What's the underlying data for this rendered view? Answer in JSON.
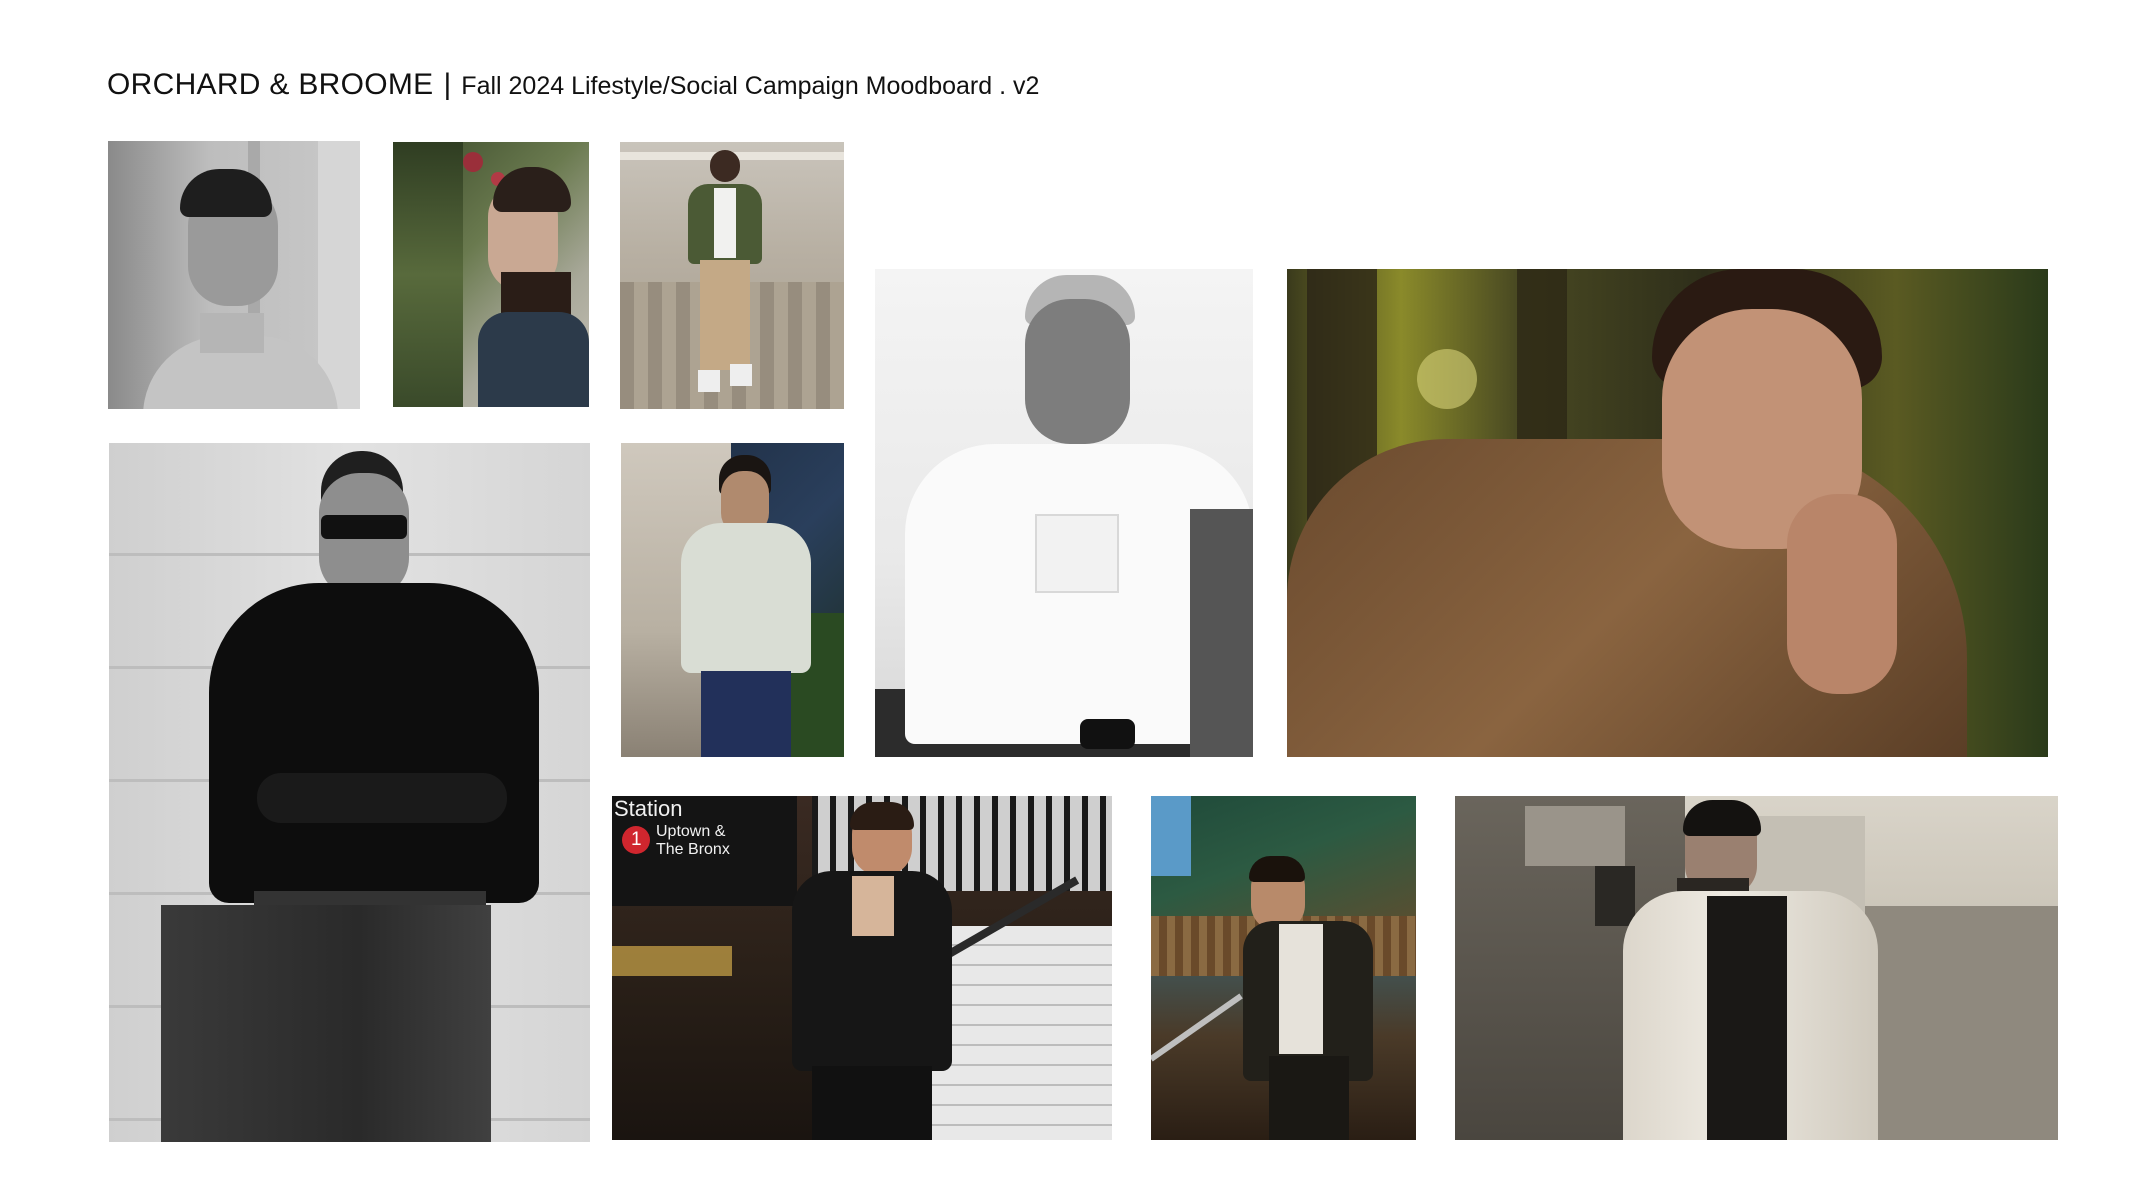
{
  "header": {
    "brand": "ORCHARD & BROOME",
    "separator": "|",
    "subtitle": "Fall 2024 Lifestyle/Social Campaign Moodboard . v2"
  },
  "photos": [
    {
      "id": "bw-man-sweatshirt",
      "style": "black-and-white"
    },
    {
      "id": "man-ivy-turtleneck",
      "style": "color"
    },
    {
      "id": "man-cobblestone-street",
      "style": "color"
    },
    {
      "id": "bw-man-turtleneck-sunglasses",
      "style": "black-and-white"
    },
    {
      "id": "man-tshirt-statue",
      "style": "color"
    },
    {
      "id": "bw-man-white-tee",
      "style": "black-and-white"
    },
    {
      "id": "man-brown-coat-autumn",
      "style": "color"
    },
    {
      "id": "man-subway-station",
      "style": "color",
      "sign": {
        "station": "Station",
        "line": "1",
        "route_line1": "Uptown &",
        "route_line2": "The Bronx"
      }
    },
    {
      "id": "man-open-shirt-awning",
      "style": "color"
    },
    {
      "id": "man-trench-coat-street",
      "style": "sepia"
    }
  ]
}
